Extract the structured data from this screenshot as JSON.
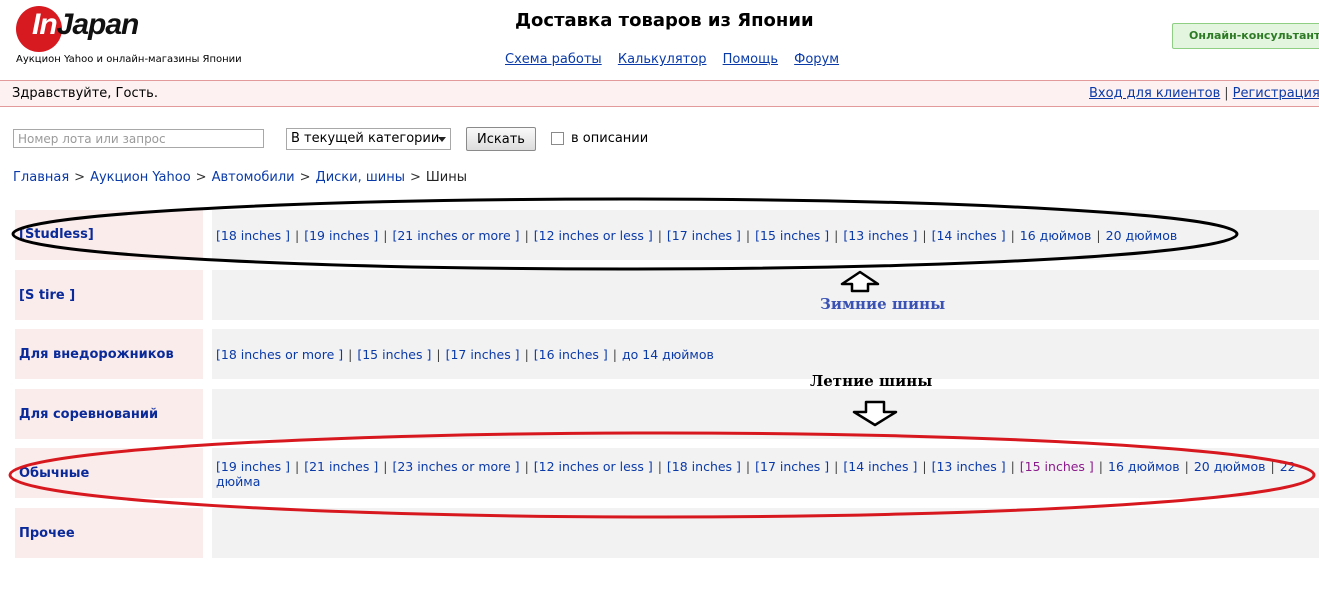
{
  "header": {
    "logo_in": "In",
    "logo_japan": "Japan",
    "logo_subtitle": "Аукцион Yahoo и онлайн-магазины Японии",
    "title": "Доставка товаров из Японии",
    "nav": [
      "Схема работы",
      "Калькулятор",
      "Помощь",
      "Форум"
    ],
    "consultant": "Онлайн-консультант"
  },
  "greeting": {
    "text": "Здравствуйте, Гость.",
    "login": "Вход для клиентов",
    "separator": "|",
    "register": "Регистрация"
  },
  "search": {
    "placeholder": "Номер лота или запрос",
    "scope": "В текущей категории",
    "button": "Искать",
    "in_description": "в описании"
  },
  "breadcrumb": {
    "items": [
      "Главная",
      "Аукцион Yahoo",
      "Автомобили",
      "Диски, шины"
    ],
    "separator": ">",
    "current": "Шины"
  },
  "rows": [
    {
      "label": "[Studless]",
      "links": [
        "[18 inches ]",
        "[19 inches ]",
        "[21 inches or more ]",
        "[12 inches or less ]",
        "[17 inches ]",
        "[15 inches ]",
        "[13 inches ]",
        "[14 inches ]",
        "16 дюймов",
        "20 дюймов"
      ]
    },
    {
      "label": "[S tire ]",
      "links": []
    },
    {
      "label": "Для внедорожников",
      "links": [
        "[18 inches or more ]",
        "[15 inches ]",
        "[17 inches ]",
        "[16 inches ]",
        "до 14 дюймов"
      ]
    },
    {
      "label": "Для соревнований",
      "links": []
    },
    {
      "label": "Обычные",
      "links": [
        "[19 inches ]",
        "[21 inches ]",
        "[23 inches or more ]",
        "[12 inches or less ]",
        "[18 inches ]",
        "[17 inches ]",
        "[14 inches ]",
        "[13 inches ]",
        "[15 inches ]",
        "16 дюймов",
        "20 дюймов",
        "22 дюйма"
      ],
      "visited_index": 8
    },
    {
      "label": "Прочее",
      "links": []
    }
  ],
  "pipe": "|",
  "annotations": {
    "winter": "Зимние шины",
    "summer": "Летние шины",
    "colors": {
      "black_ellipse": "#000000",
      "red_ellipse": "#d7191f",
      "winter_text": "#3a52b4"
    }
  }
}
